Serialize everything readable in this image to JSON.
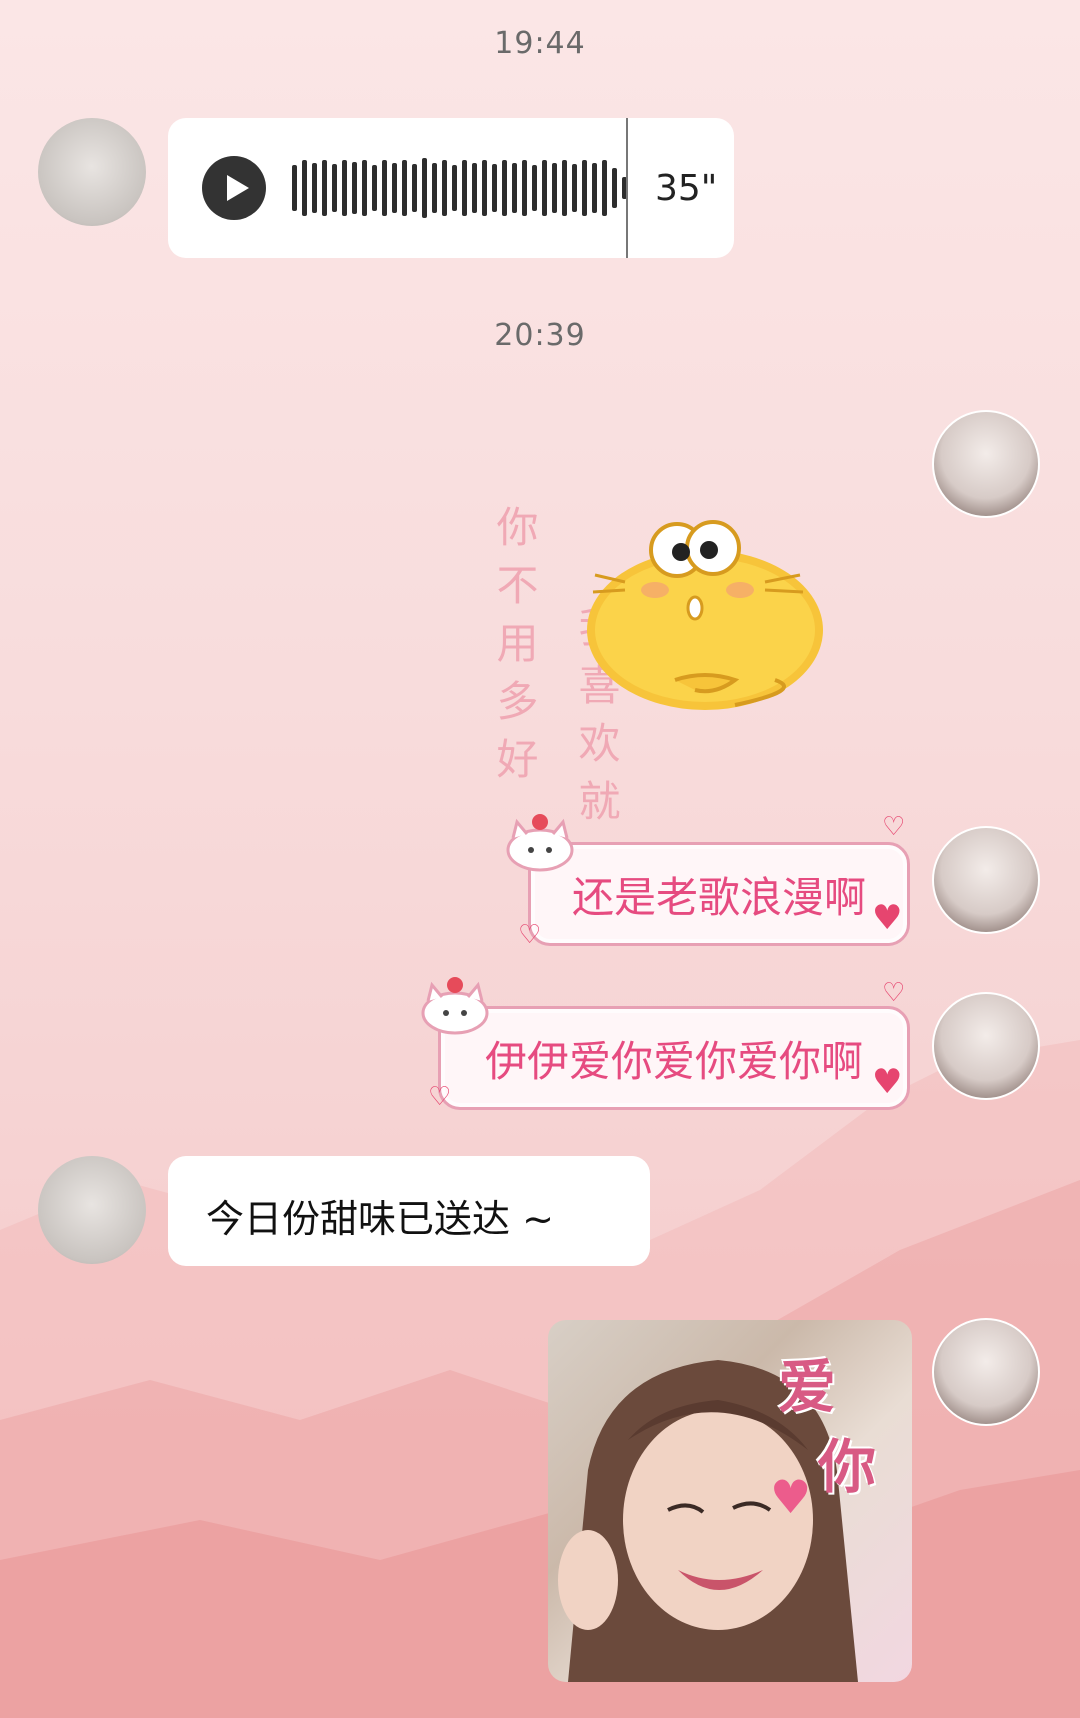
{
  "timestamps": [
    "19:44",
    "20:39"
  ],
  "voice_message": {
    "duration": "35\""
  },
  "background_text": {
    "column1": "你不用多好",
    "column2": "我喜欢就"
  },
  "messages": {
    "sticker_cat": "cat-sticker",
    "pink1": "还是老歌浪漫啊",
    "pink2": "伊伊爱你爱你爱你啊",
    "incoming_text": "今日份甜味已送达 ~",
    "photo_caption1": "爱",
    "photo_caption2": "你"
  },
  "colors": {
    "background": "#f8dcdc",
    "pink_text": "#e64b80",
    "bubble_border": "#e7a0b4"
  }
}
